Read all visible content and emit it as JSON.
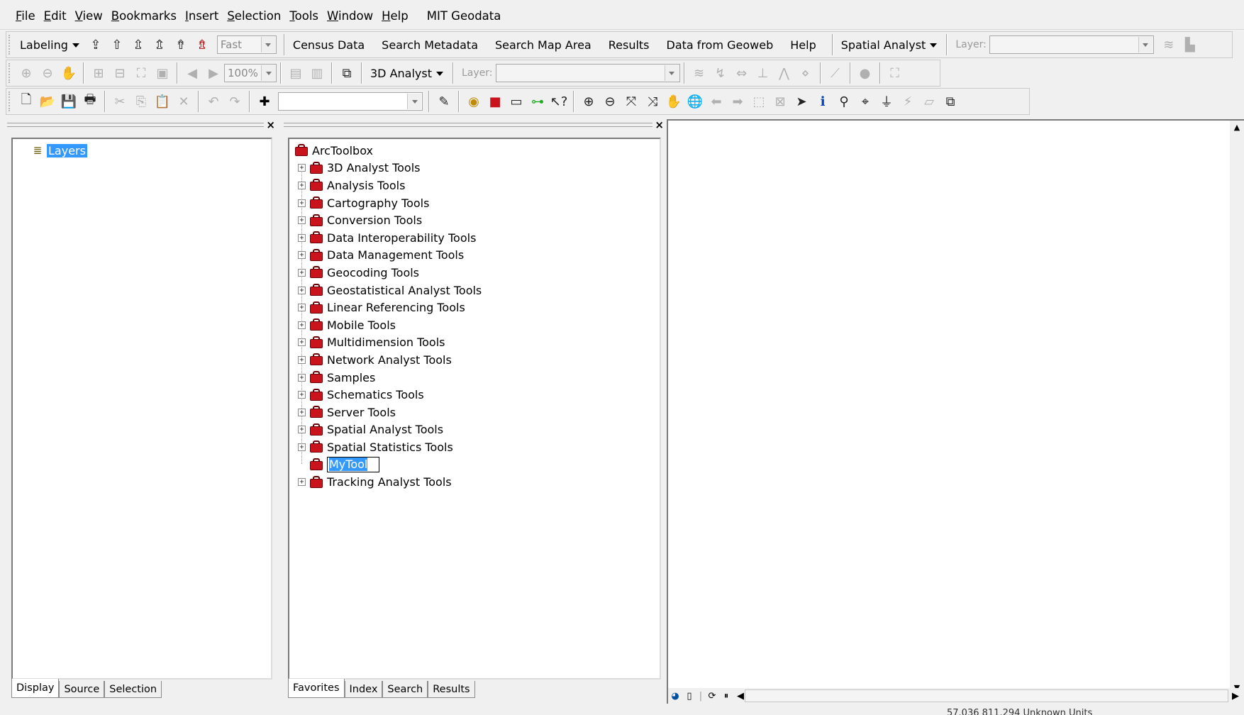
{
  "menu": {
    "items": [
      {
        "acc": "F",
        "rest": "ile"
      },
      {
        "acc": "E",
        "rest": "dit"
      },
      {
        "acc": "V",
        "rest": "iew"
      },
      {
        "acc": "B",
        "rest": "ookmarks"
      },
      {
        "acc": "I",
        "rest": "nsert"
      },
      {
        "acc": "S",
        "rest": "election"
      },
      {
        "acc": "T",
        "rest": "ools"
      },
      {
        "acc": "W",
        "rest": "indow"
      },
      {
        "acc": "H",
        "rest": "elp"
      }
    ],
    "extra": "MIT Geodata"
  },
  "toolbar1": {
    "labeling": "Labeling",
    "quality": "Fast",
    "links": [
      "Census Data",
      "Search Metadata",
      "Search Map Area",
      "Results",
      "Data from Geoweb",
      "Help"
    ],
    "spatial_analyst": "Spatial Analyst",
    "layer_label": "Layer:"
  },
  "toolbar2": {
    "zoom": "100%",
    "analyst_3d": "3D Analyst",
    "layer_label": "Layer:"
  },
  "toolbar3": {
    "scale_value": ""
  },
  "table_of_contents": {
    "root": "Layers",
    "tabs": [
      "Display",
      "Source",
      "Selection"
    ]
  },
  "arctoolbox": {
    "root": "ArcToolbox",
    "items": [
      "3D Analyst Tools",
      "Analysis Tools",
      "Cartography Tools",
      "Conversion Tools",
      "Data Interoperability Tools",
      "Data Management Tools",
      "Geocoding Tools",
      "Geostatistical Analyst Tools",
      "Linear Referencing Tools",
      "Mobile Tools",
      "Multidimension Tools",
      "Network Analyst Tools",
      "Samples",
      "Schematics Tools",
      "Server Tools",
      "Spatial Analyst Tools",
      "Spatial Statistics Tools",
      "MyTool",
      "Tracking Analyst Tools"
    ],
    "editing_item": "MyTool",
    "tabs": [
      "Favorites",
      "Index",
      "Search",
      "Results"
    ]
  },
  "status": {
    "coordinates": "57.036  811.294 Unknown Units"
  },
  "colors": {
    "selection": "#3399ff",
    "toolbox_red": "#c9141d",
    "window_bg": "#f0f0f0"
  }
}
